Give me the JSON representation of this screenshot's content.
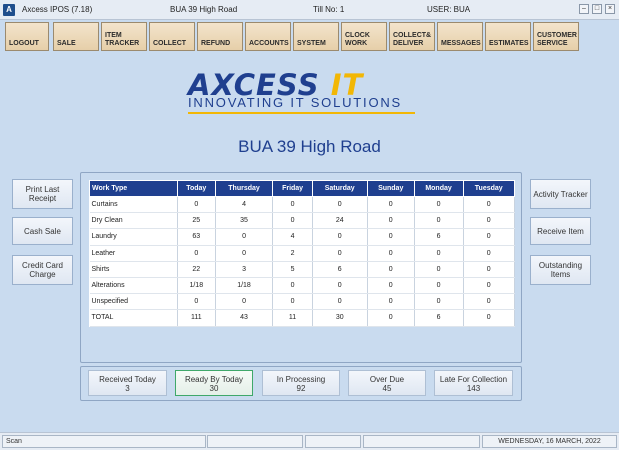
{
  "titlebar": {
    "app_name": "Axcess IPOS (7.18)",
    "store": "BUA 39 High Road",
    "till": "Till No: 1",
    "user": "USER: BUA"
  },
  "toolbar": [
    {
      "name": "toolbar-logout-button",
      "label": "LOGOUT"
    },
    {
      "name": "toolbar-sale-button",
      "label": "SALE"
    },
    {
      "name": "toolbar-item-tracker-button",
      "label": "ITEM\nTRACKER"
    },
    {
      "name": "toolbar-collect-button",
      "label": "COLLECT"
    },
    {
      "name": "toolbar-refund-button",
      "label": "REFUND"
    },
    {
      "name": "toolbar-accounts-button",
      "label": "ACCOUNTS"
    },
    {
      "name": "toolbar-system-button",
      "label": "SYSTEM"
    },
    {
      "name": "toolbar-clock-work-button",
      "label": "CLOCK\nWORK"
    },
    {
      "name": "toolbar-collect-deliver-button",
      "label": "COLLECT&\nDELIVER"
    },
    {
      "name": "toolbar-messages-button",
      "label": "MESSAGES"
    },
    {
      "name": "toolbar-estimates-button",
      "label": "ESTIMATES"
    },
    {
      "name": "toolbar-customer-service-button",
      "label": "CUSTOMER\nSERVICE"
    }
  ],
  "logo": {
    "part1": "AXCESS",
    "part2": "IT",
    "tagline": "INNOVATING IT SOLUTIONS"
  },
  "store_title": "BUA 39 High Road",
  "left_buttons": [
    "Print Last\nReceipt",
    "Cash Sale",
    "Credit Card\nCharge"
  ],
  "right_buttons": [
    "Activity Tracker",
    "Receive Item",
    "Outstanding\nItems"
  ],
  "table": {
    "headers": [
      "Work Type",
      "Today",
      "Thursday",
      "Friday",
      "Saturday",
      "Sunday",
      "Monday",
      "Tuesday"
    ],
    "rows": [
      [
        "Curtains",
        "0",
        "4",
        "0",
        "0",
        "0",
        "0",
        "0"
      ],
      [
        "Dry Clean",
        "25",
        "35",
        "0",
        "24",
        "0",
        "0",
        "0"
      ],
      [
        "Laundry",
        "63",
        "0",
        "4",
        "0",
        "0",
        "6",
        "0"
      ],
      [
        "Leather",
        "0",
        "0",
        "2",
        "0",
        "0",
        "0",
        "0"
      ],
      [
        "Shirts",
        "22",
        "3",
        "5",
        "6",
        "0",
        "0",
        "0"
      ],
      [
        "Alterations",
        "1/18",
        "1/18",
        "0",
        "0",
        "0",
        "0",
        "0"
      ],
      [
        "Unspecified",
        "0",
        "0",
        "0",
        "0",
        "0",
        "0",
        "0"
      ],
      [
        "TOTAL",
        "111",
        "43",
        "11",
        "30",
        "0",
        "6",
        "0"
      ]
    ]
  },
  "summary": [
    {
      "label": "Received Today",
      "value": "3"
    },
    {
      "label": "Ready By Today",
      "value": "30"
    },
    {
      "label": "In Processing",
      "value": "92"
    },
    {
      "label": "Over Due",
      "value": "45"
    },
    {
      "label": "Late For Collection",
      "value": "143"
    }
  ],
  "statusbar": {
    "left": "Scan",
    "date": "WEDNESDAY, 16 MARCH, 2022"
  },
  "colors": {
    "accent": "#1f3f8f",
    "logo_yellow": "#f2b705",
    "background": "#c9dbef",
    "toolbar_button": "#e6cfa9"
  }
}
